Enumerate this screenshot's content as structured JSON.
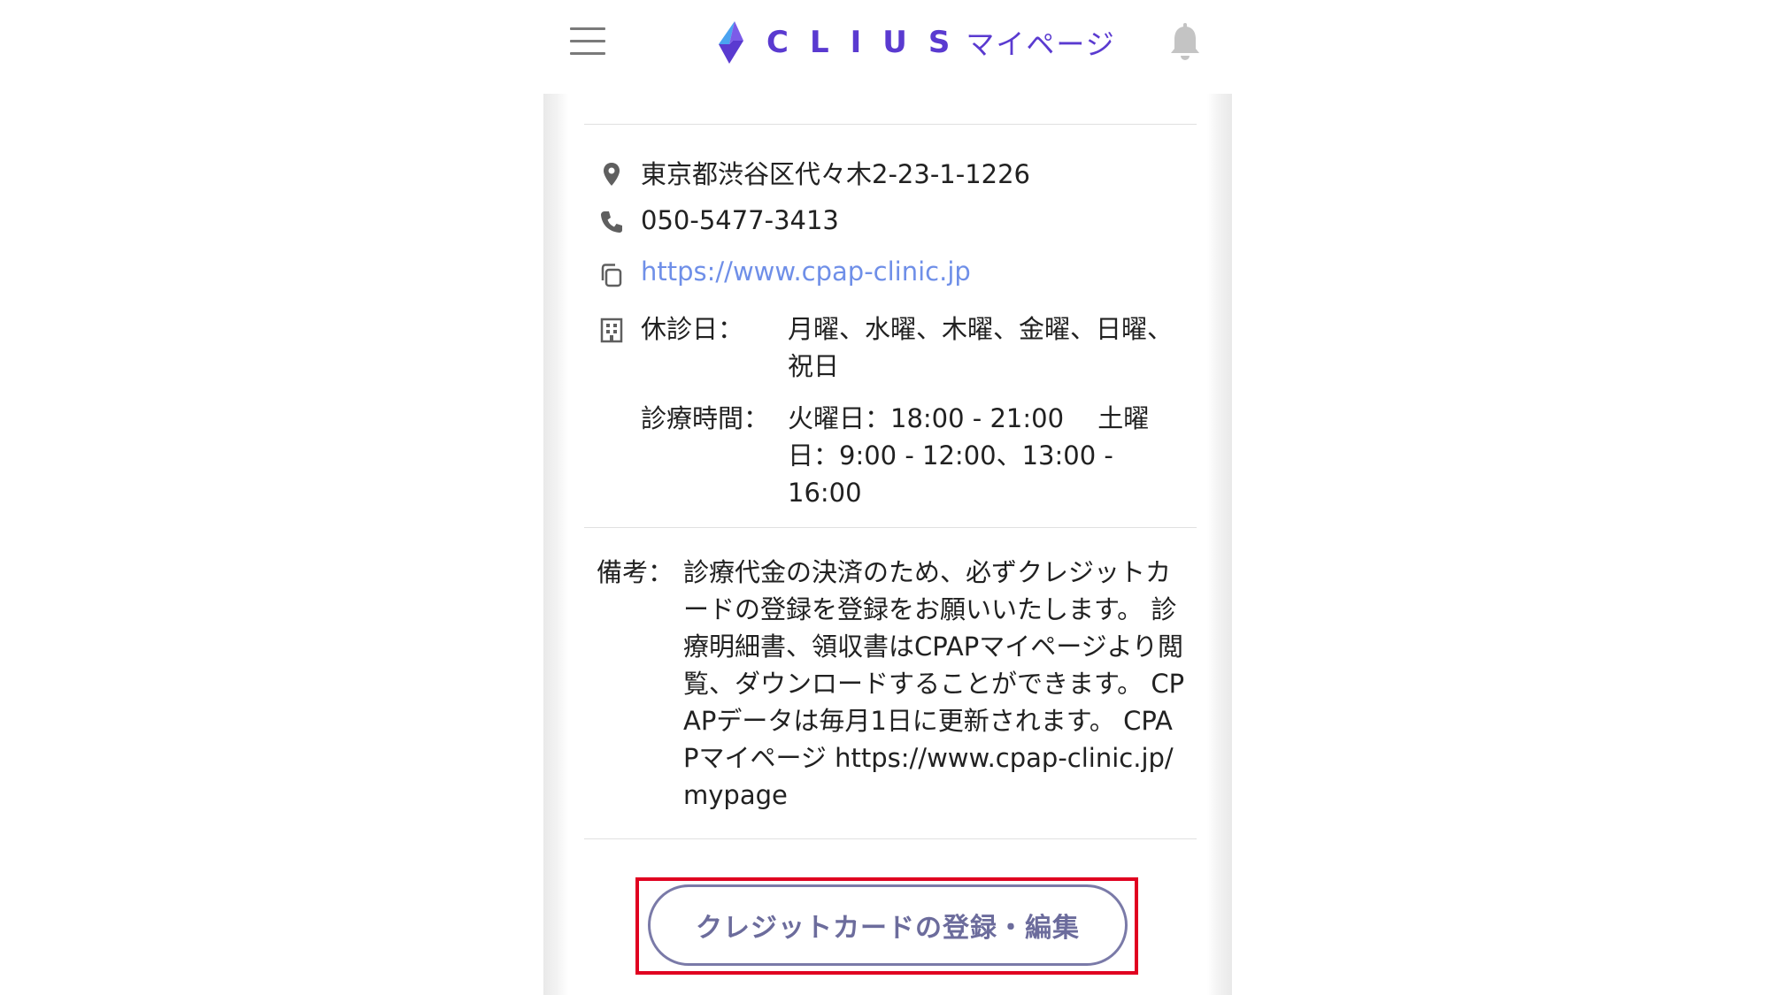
{
  "header": {
    "brand_name": "CLIUS",
    "brand_sub": "マイページ",
    "brand_color": "#5a3ad0",
    "menu_icon": "hamburger-menu-icon",
    "notification_icon": "bell-icon"
  },
  "clinic": {
    "address": "東京都渋谷区代々木2-23-1-1226",
    "phone": "050-5477-3413",
    "website": "https://www.cpap-clinic.jp",
    "holidays_label": "休診日：",
    "holidays_value": "月曜、水曜、木曜、金曜、日曜、祝日",
    "hours_label": "診療時間：",
    "hours_value": "火曜日：18:00 - 21:00　 土曜日：9:00 - 12:00、13:00 - 16:00"
  },
  "notes": {
    "label": "備考：",
    "body": "診療代金の決済のため、必ずクレジットカードの登録を登録をお願いいたします。 診療明細書、領収書はCPAPマイページより閲覧、ダウンロードすることができます。 CPAPデータは毎月1日に更新されます。 CPAPマイページ https://www.cpap-clinic.jp/mypage"
  },
  "actions": {
    "credit_card_button": "クレジットカードの登録・編集",
    "highlight_color": "#e00020"
  }
}
